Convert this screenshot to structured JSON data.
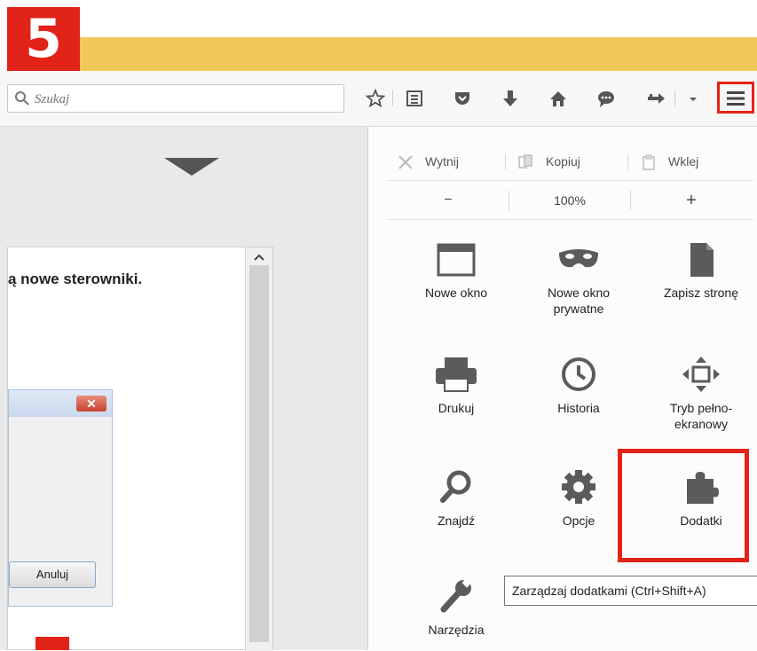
{
  "step": {
    "number": "5"
  },
  "search": {
    "placeholder": "Szukaj"
  },
  "toolbar_icons": [
    "star-icon",
    "reading-list-icon",
    "pocket-icon",
    "download-icon",
    "home-icon",
    "chat-icon",
    "extension-icon",
    "dropdown-arrow-icon",
    "hamburger-menu-icon"
  ],
  "dialog": {
    "title": "ą nowe sterowniki.",
    "cancel_label": "Anuluj",
    "close_label": "✕"
  },
  "menu": {
    "edit": {
      "cut": "Wytnij",
      "copy": "Kopiuj",
      "paste": "Wklej"
    },
    "zoom": {
      "minus": "−",
      "level": "100%",
      "plus": "+"
    },
    "items": [
      {
        "label": "Nowe okno",
        "icon": "window-icon"
      },
      {
        "label": "Nowe okno prywatne",
        "icon": "mask-icon"
      },
      {
        "label": "Zapisz stronę",
        "icon": "page-icon"
      },
      {
        "label": "Drukuj",
        "icon": "printer-icon"
      },
      {
        "label": "Historia",
        "icon": "clock-icon"
      },
      {
        "label": "Tryb pełno-ekranowy",
        "icon": "fullscreen-icon"
      },
      {
        "label": "Znajdź",
        "icon": "magnifier-icon"
      },
      {
        "label": "Opcje",
        "icon": "gear-icon"
      },
      {
        "label": "Dodatki",
        "icon": "puzzle-icon"
      },
      {
        "label": "Narzędzia",
        "icon": "wrench-icon"
      }
    ]
  },
  "tooltip": {
    "text": "Zarządzaj dodatkami (Ctrl+Shift+A)"
  },
  "colors": {
    "accent_red": "#e2231a",
    "tab_yellow": "#f2c85b",
    "icon_gray": "#5b5b5b"
  }
}
